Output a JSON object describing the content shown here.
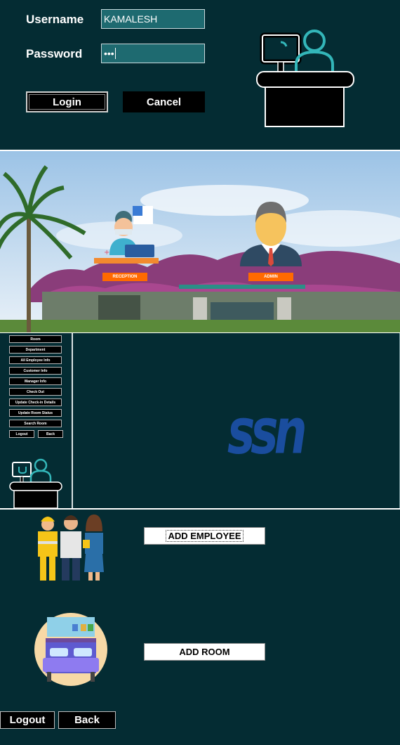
{
  "login": {
    "username_label": "Username",
    "username_value": "KAMALESH",
    "password_label": "Password",
    "password_value": "•••",
    "login_label": "Login",
    "cancel_label": "Cancel"
  },
  "scene": {
    "reception_label": "RECEPTION",
    "admin_label": "ADMIN"
  },
  "dashboard": {
    "menu": [
      "Room",
      "Department",
      "All Employee Info",
      "Customer Info",
      "Manager Info",
      "Check Out",
      "Update Check-in Details",
      "Update Room Status",
      "Search Room"
    ],
    "logout_label": "Logout",
    "back_label": "Back",
    "logo_text": "SSN"
  },
  "admin": {
    "add_employee_label": "ADD EMPLOYEE",
    "add_room_label": "ADD ROOM",
    "logout_label": "Logout",
    "back_label": "Back"
  },
  "colors": {
    "panel": "#042c33",
    "field": "#1e6a70",
    "accent": "#ff6a00",
    "logo": "#1a4d9e"
  }
}
